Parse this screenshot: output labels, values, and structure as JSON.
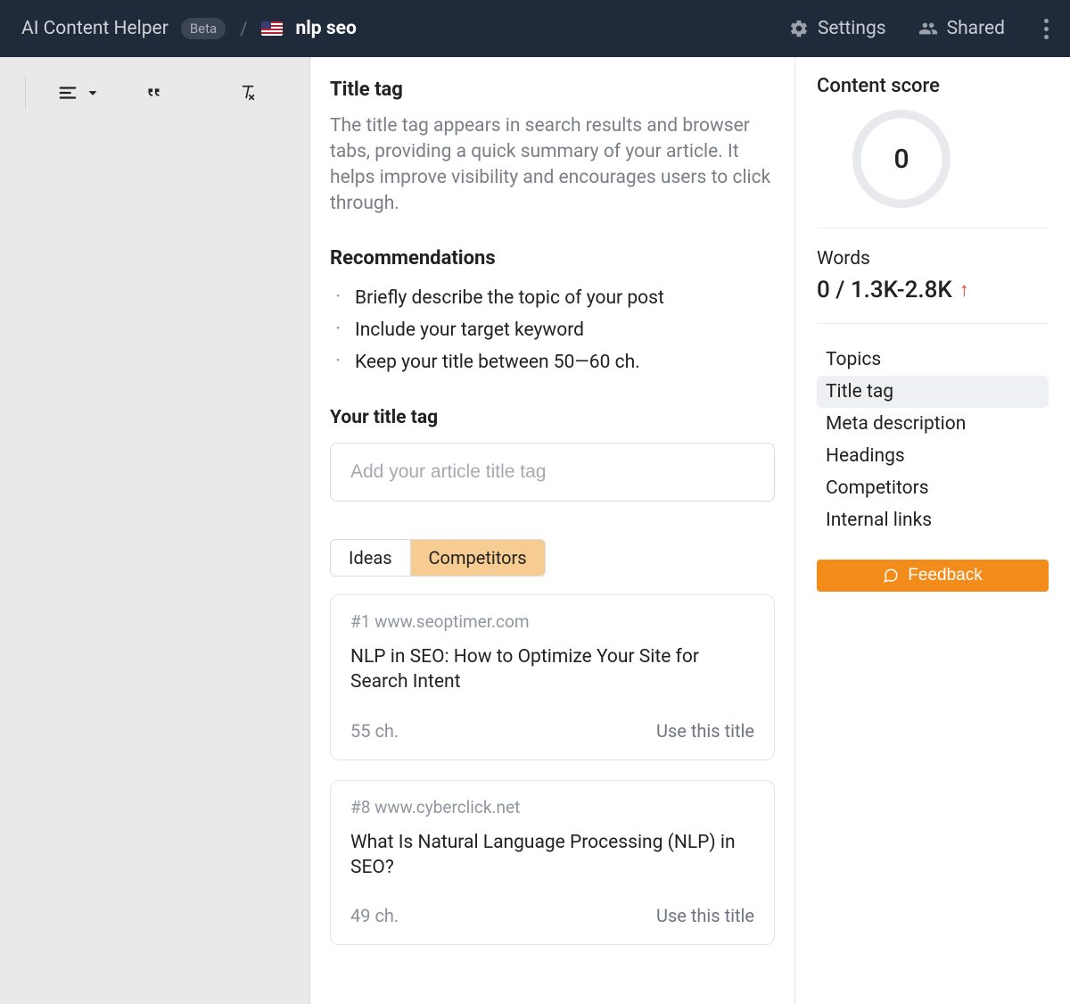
{
  "header": {
    "brand": "AI Content Helper",
    "badge": "Beta",
    "doc_title": "nlp seo",
    "settings": "Settings",
    "shared": "Shared"
  },
  "main": {
    "section_title": "Title tag",
    "lead": "The title tag appears in search results and browser tabs, providing a quick summary of your article. It helps improve visibility and encourages users to click through.",
    "recs_title": "Recommendations",
    "recs": [
      "Briefly describe the topic of your post",
      "Include your target keyword",
      "Keep your title between 50—60 ch."
    ],
    "input_label": "Your title tag",
    "input_placeholder": "Add your article title tag",
    "tabs": {
      "ideas": "Ideas",
      "competitors": "Competitors"
    },
    "cards": [
      {
        "meta": "#1 www.seoptimer.com",
        "title": "NLP in SEO: How to Optimize Your Site for Search Intent",
        "chars": "55 ch.",
        "use": "Use this title"
      },
      {
        "meta": "#8 www.cyberclick.net",
        "title": "What Is Natural Language Processing (NLP) in SEO?",
        "chars": "49 ch.",
        "use": "Use this title"
      }
    ]
  },
  "sidebar": {
    "score_label": "Content score",
    "score_value": "0",
    "words_label": "Words",
    "words_value": "0 / 1.3K-2.8K",
    "nav": [
      "Topics",
      "Title tag",
      "Meta description",
      "Headings",
      "Competitors",
      "Internal links"
    ],
    "nav_active_index": 1,
    "feedback": "Feedback"
  }
}
